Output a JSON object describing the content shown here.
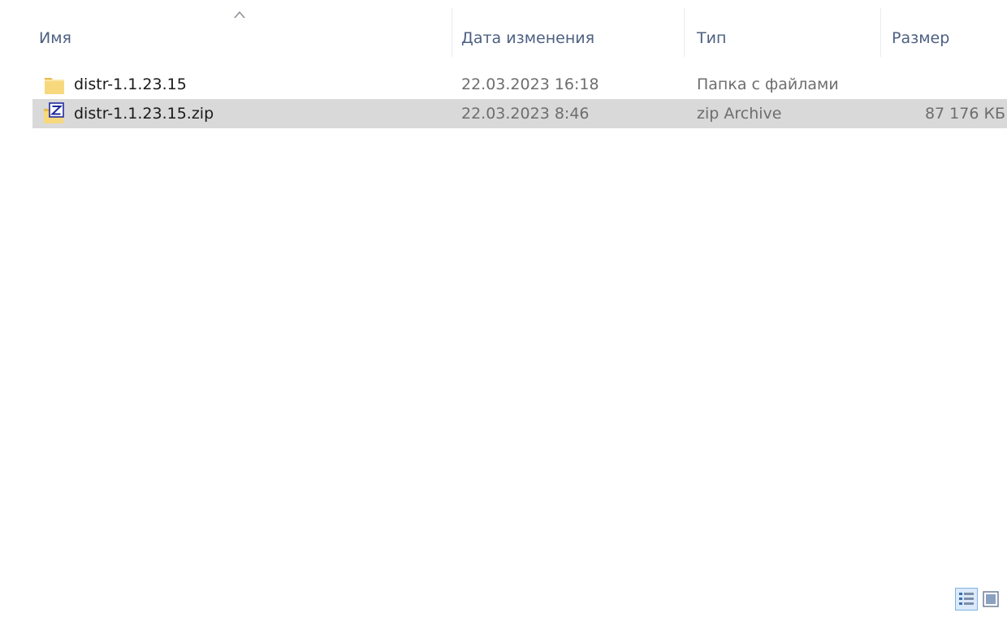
{
  "header": {
    "name": "Имя",
    "date": "Дата изменения",
    "type": "Тип",
    "size": "Размер"
  },
  "files": [
    {
      "icon": "folder-icon",
      "name": "distr-1.1.23.15",
      "date": "22.03.2023 16:18",
      "type": "Папка с файлами",
      "size": "",
      "selected": false
    },
    {
      "icon": "zip-archive-icon",
      "name": "distr-1.1.23.15.zip",
      "date": "22.03.2023 8:46",
      "type": "zip Archive",
      "size": "87 176 КБ",
      "selected": true
    }
  ],
  "view": {
    "active": "details"
  },
  "colors": {
    "header_text": "#4d6082",
    "selection": "#d9d9d9",
    "folder": "#f7d87c"
  }
}
